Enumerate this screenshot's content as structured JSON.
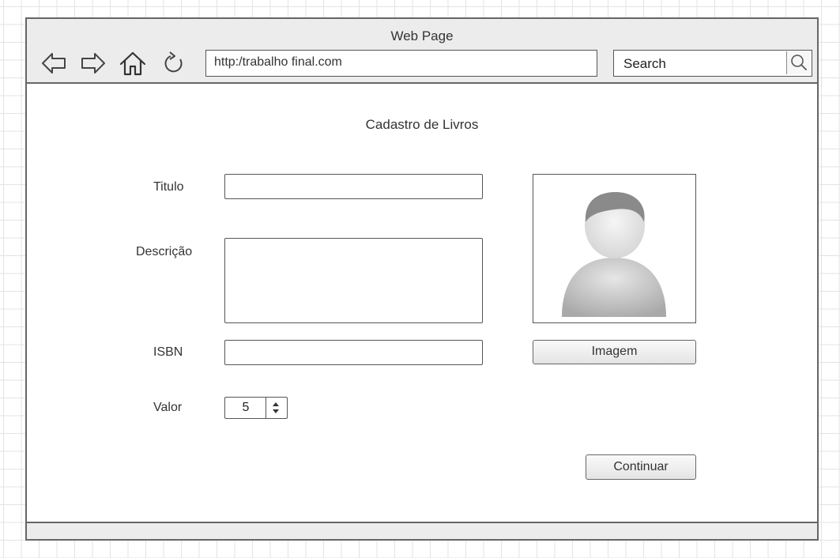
{
  "window": {
    "title": "Web Page"
  },
  "navbar": {
    "url": "http:/trabalho final.com",
    "search_placeholder": "Search",
    "icons": [
      "back-arrow-icon",
      "forward-arrow-icon",
      "home-icon",
      "reload-icon",
      "search-icon"
    ]
  },
  "form": {
    "title": "Cadastro de Livros",
    "titulo_label": "Titulo",
    "titulo_value": "",
    "descricao_label": "Descrição",
    "descricao_value": "",
    "isbn_label": "ISBN",
    "isbn_value": "",
    "valor_label": "Valor",
    "valor_value": "5",
    "image_button_label": "Imagem",
    "continue_button_label": "Continuar"
  }
}
